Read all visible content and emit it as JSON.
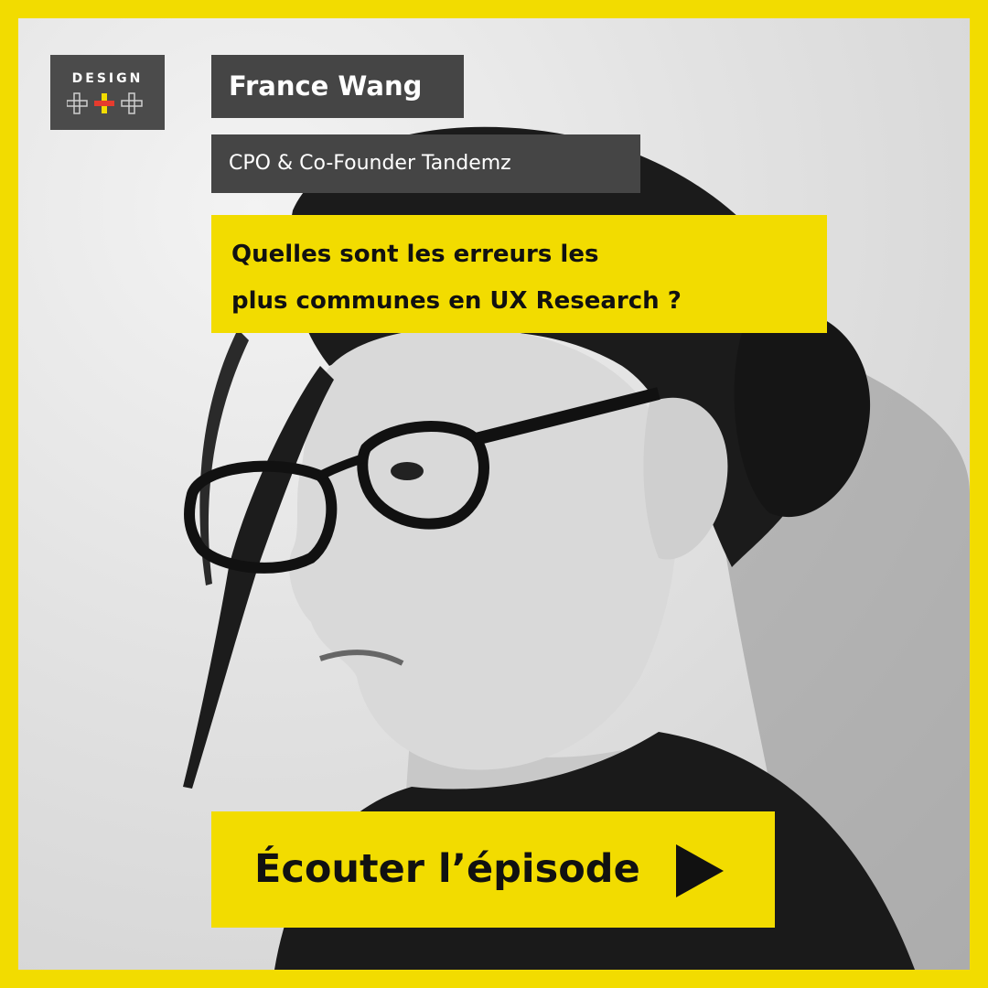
{
  "logo": {
    "text": "DESIGN",
    "icon": "plus-plus-plus-icon"
  },
  "speaker": {
    "name": "France Wang",
    "role": "CPO & Co-Founder Tandemz"
  },
  "question": {
    "line1": "Quelles sont les erreurs les",
    "line2": "plus communes en UX Research ?"
  },
  "cta": {
    "label": "Écouter l’épisode",
    "icon": "play-icon"
  },
  "colors": {
    "frame": "#f2dc00",
    "tag_background": "#454545",
    "logo_background": "#4b4b4b",
    "accent_red": "#e63b2e"
  }
}
